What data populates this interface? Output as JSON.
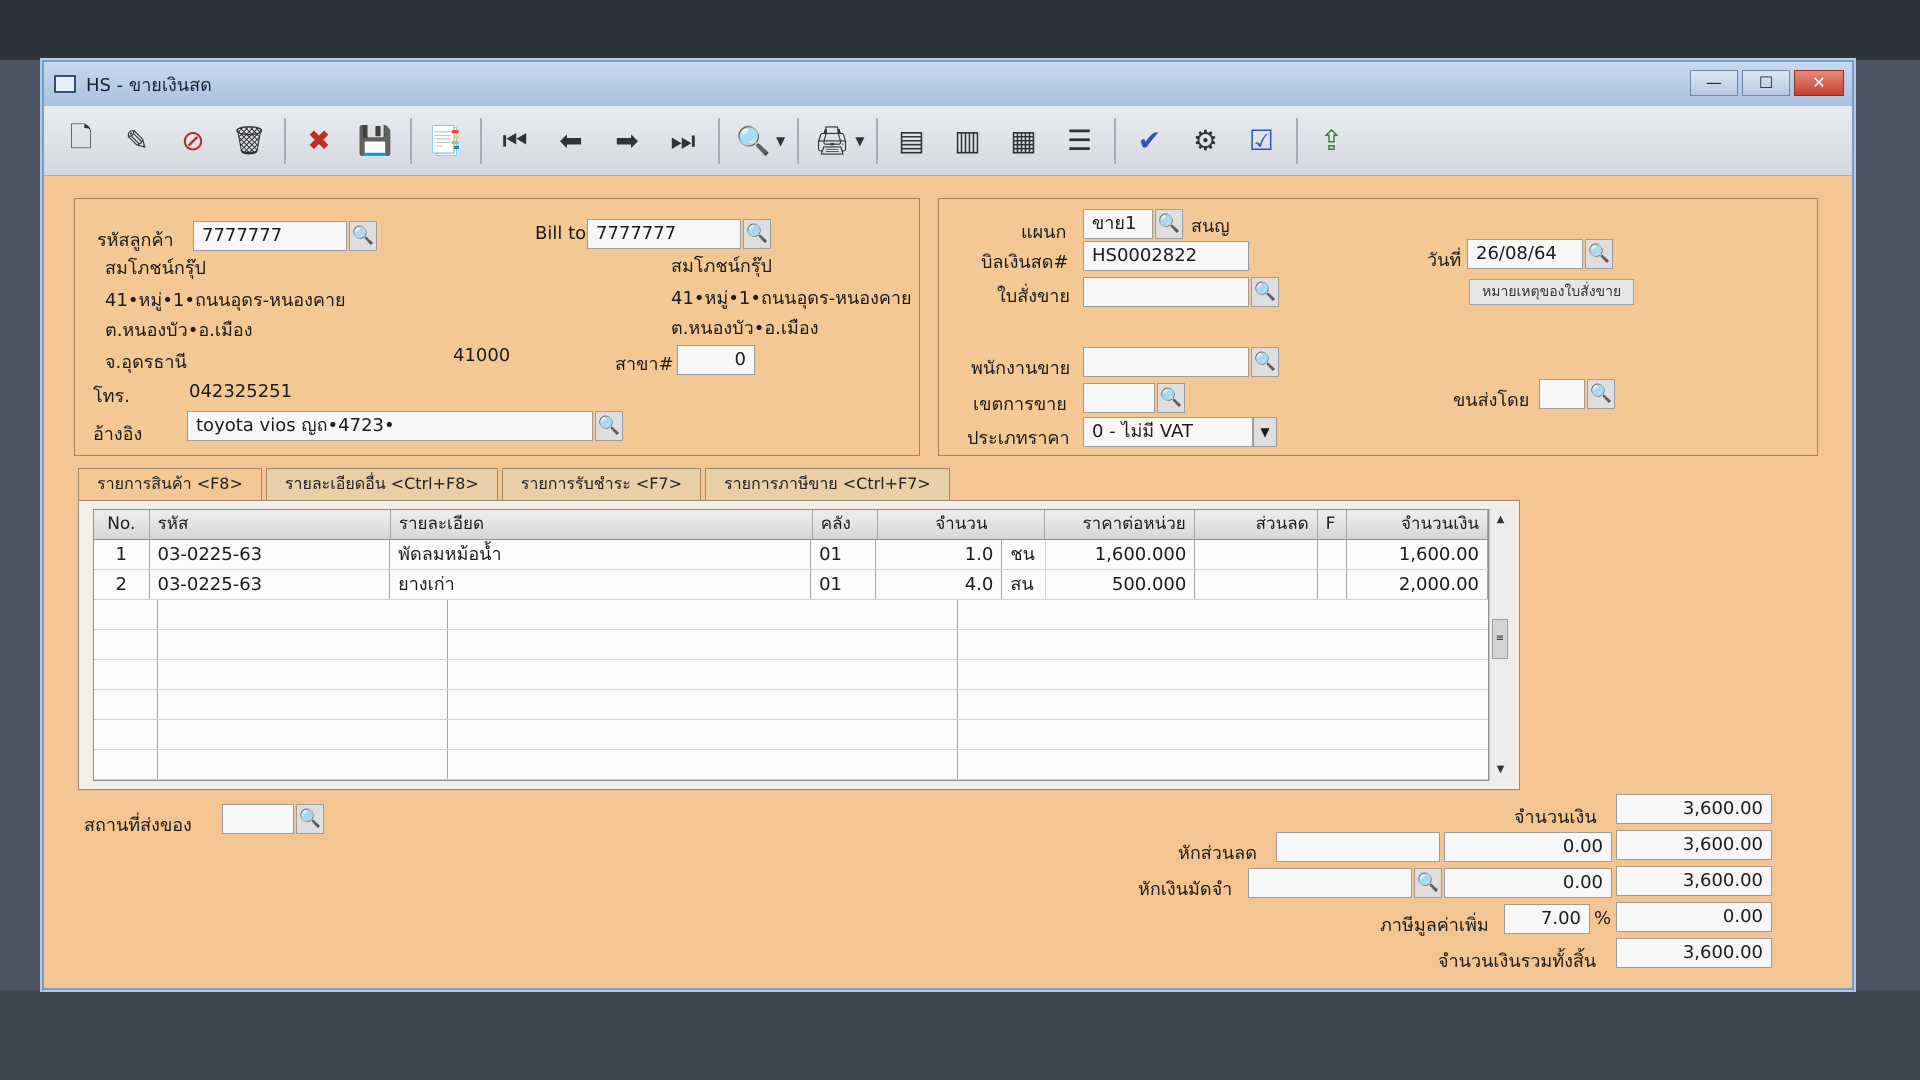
{
  "window": {
    "title": "HS - ขายเงินสด",
    "minimize": "—",
    "maximize": "☐",
    "close": "✕"
  },
  "toolbar": {
    "buttons": [
      {
        "name": "new-doc-icon",
        "glyph": "🗋"
      },
      {
        "name": "edit-icon",
        "glyph": "✎"
      },
      {
        "name": "void-icon",
        "glyph": "⊘"
      },
      {
        "name": "trash-icon",
        "glyph": "🗑"
      },
      {
        "name": "cancel-icon",
        "glyph": "✖"
      },
      {
        "name": "save-icon",
        "glyph": "💾"
      },
      {
        "name": "copy-icon",
        "glyph": "📑"
      },
      {
        "name": "first-record-icon",
        "glyph": "⏮"
      },
      {
        "name": "prev-record-icon",
        "glyph": "⬅"
      },
      {
        "name": "next-record-icon",
        "glyph": "➡"
      },
      {
        "name": "last-record-icon",
        "glyph": "⏭"
      },
      {
        "name": "find-icon",
        "glyph": "🔍"
      },
      {
        "name": "print-icon",
        "glyph": "🖨"
      },
      {
        "name": "report-icon",
        "glyph": "▤"
      },
      {
        "name": "form-icon",
        "glyph": "▥"
      },
      {
        "name": "chart-icon",
        "glyph": "▦"
      },
      {
        "name": "journal-icon",
        "glyph": "☰"
      },
      {
        "name": "approve-icon",
        "glyph": "✔"
      },
      {
        "name": "tools-icon",
        "glyph": "⚙"
      },
      {
        "name": "confirm-ok-icon",
        "glyph": "☑"
      },
      {
        "name": "export-icon",
        "glyph": "⇪"
      }
    ]
  },
  "customer": {
    "code_label": "รหัสลูกค้า",
    "code": "7777777",
    "name": "สมโภชน์กรุ๊ป",
    "addr1": "41•หมู่•1•ถนนอุดร-หนองคาย",
    "addr2": "ต.หนองบัว•อ.เมือง",
    "addr3": "จ.อุดรธานี",
    "zip": "41000",
    "phone_label": "โทร.",
    "phone": "042325251",
    "ref_label": "อ้างอิง",
    "ref": "toyota vios ญถ•4723•"
  },
  "bill_to": {
    "label": "Bill to",
    "code": "7777777",
    "name": "สมโภชน์กรุ๊ป",
    "addr1": "41•หมู่•1•ถนนอุดร-หนองคาย",
    "addr2": "ต.หนองบัว•อ.เมือง",
    "branch_label": "สาขา#",
    "branch": "0"
  },
  "header": {
    "dept_label": "แผนก",
    "dept": "ขาย1",
    "dept_name": "สนญ",
    "bill_no_label": "บิลเงินสด#",
    "bill_no": "HS0002822",
    "so_label": "ใบสั่งขาย",
    "so": "",
    "date_label": "วันที่",
    "date": "26/08/64",
    "note_button": "หมายเหตุของใบสั่งขาย",
    "salesman_label": "พนักงานขาย",
    "salesman": "",
    "area_label": "เขตการขาย",
    "area": "",
    "ship_by_label": "ขนส่งโดย",
    "ship_by": "",
    "price_type_label": "ประเภทราคา",
    "price_type": "0 - ไม่มี VAT"
  },
  "tabs": [
    {
      "label": "รายการสินค้า <F8>"
    },
    {
      "label": "รายละเอียดอื่น <Ctrl+F8>"
    },
    {
      "label": "รายการรับชำระ <F7>"
    },
    {
      "label": "รายการภาษีขาย <Ctrl+F7>"
    }
  ],
  "grid": {
    "columns": {
      "no": "No.",
      "code": "รหัส",
      "desc": "รายละเอียด",
      "wh": "คลัง",
      "qty": "จำนวน",
      "price": "ราคาต่อหน่วย",
      "disc": "ส่วนลด",
      "f": "F",
      "amount": "จำนวนเงิน"
    },
    "rows": [
      {
        "no": "1",
        "code": "03-0225-63",
        "desc": "พัดลมหม้อน้ำ",
        "wh": "01",
        "qty": "1.0",
        "unit": "ชน",
        "price": "1,600.000",
        "disc": "",
        "f": "",
        "amount": "1,600.00"
      },
      {
        "no": "2",
        "code": "03-0225-63",
        "desc": "ยางเก่า",
        "wh": "01",
        "qty": "4.0",
        "unit": "สน",
        "price": "500.000",
        "disc": "",
        "f": "",
        "amount": "2,000.00"
      }
    ]
  },
  "footer": {
    "ship_place_label": "สถานที่ส่งของ",
    "ship_place": "",
    "amount_label": "จำนวนเงิน",
    "amount": "3,600.00",
    "discount_label": "หักส่วนลด",
    "discount_text": "",
    "discount_value": "0.00",
    "after_discount": "3,600.00",
    "deposit_label": "หักเงินมัดจำ",
    "deposit_text": "",
    "deposit_value": "0.00",
    "after_deposit": "3,600.00",
    "vat_label": "ภาษีมูลค่าเพิ่ม",
    "vat_rate": "7.00",
    "vat_pct": "%",
    "vat_amount": "0.00",
    "total_label": "จำนวนเงินรวมทั้งสิ้น",
    "total": "3,600.00"
  }
}
